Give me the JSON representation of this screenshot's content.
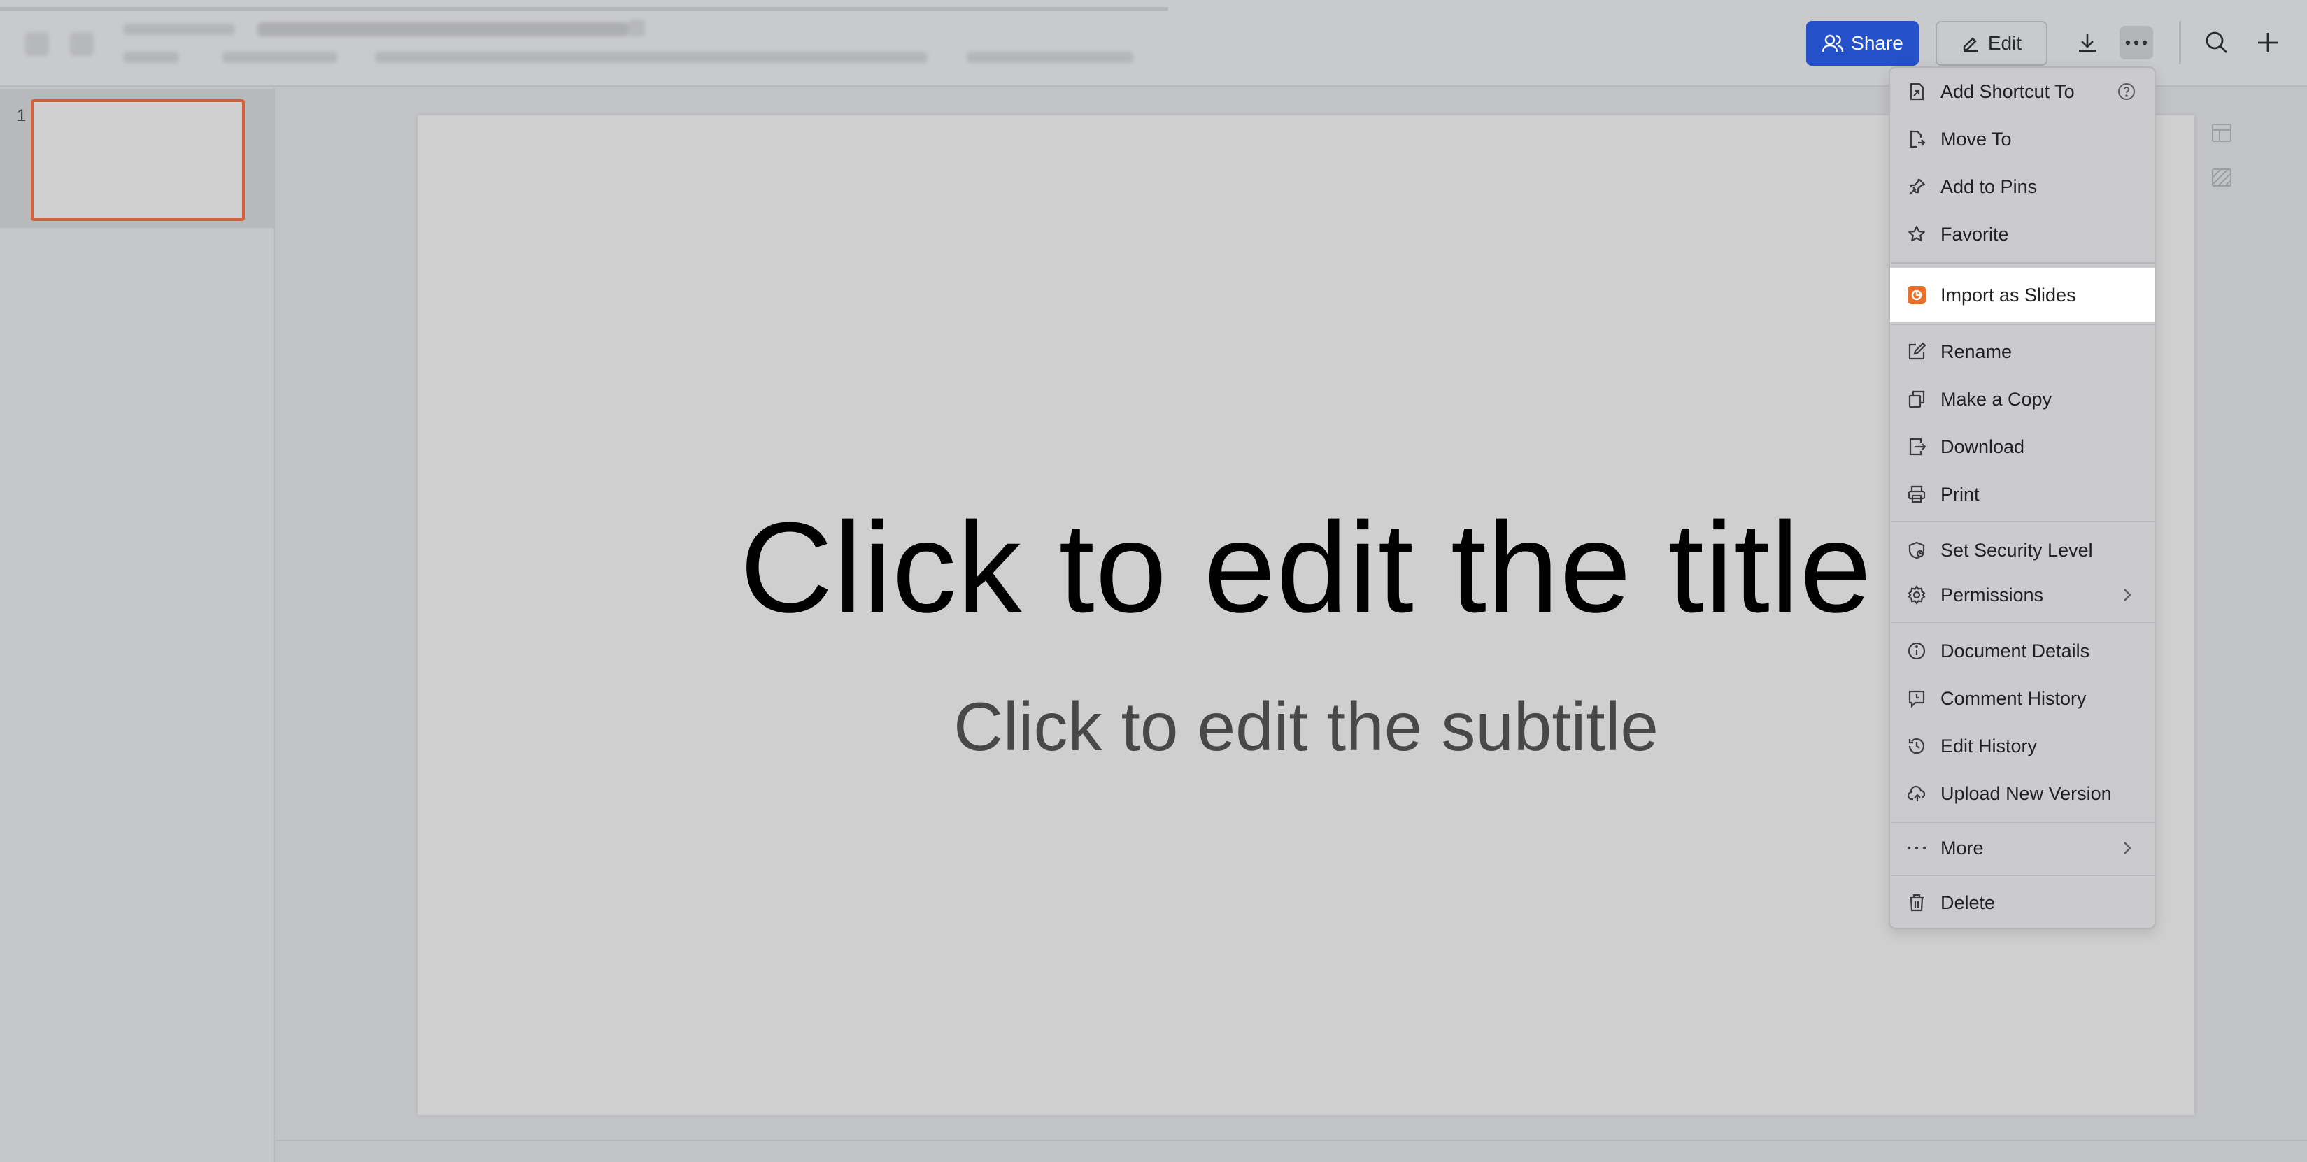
{
  "toolbar": {
    "share_label": "Share",
    "edit_label": "Edit"
  },
  "sidebar": {
    "slides": [
      {
        "number": "1"
      }
    ]
  },
  "slide": {
    "title": "Click to edit the title",
    "subtitle": "Click to edit the subtitle"
  },
  "menu": {
    "items": [
      {
        "label": "Add Shortcut To",
        "icon": "add-shortcut-icon"
      },
      {
        "label": "Move To",
        "icon": "move-to-icon"
      },
      {
        "label": "Add to Pins",
        "icon": "pin-icon"
      },
      {
        "label": "Favorite",
        "icon": "star-icon"
      },
      {
        "label": "Import as Slides",
        "icon": "slides-app-icon"
      },
      {
        "label": "Rename",
        "icon": "rename-icon"
      },
      {
        "label": "Make a Copy",
        "icon": "copy-icon"
      },
      {
        "label": "Download",
        "icon": "download-icon"
      },
      {
        "label": "Print",
        "icon": "print-icon"
      },
      {
        "label": "Set Security Level",
        "icon": "security-icon"
      },
      {
        "label": "Permissions",
        "icon": "gear-icon"
      },
      {
        "label": "Document Details",
        "icon": "info-icon"
      },
      {
        "label": "Comment History",
        "icon": "comment-history-icon"
      },
      {
        "label": "Edit History",
        "icon": "history-icon"
      },
      {
        "label": "Upload New Version",
        "icon": "cloud-upload-icon"
      },
      {
        "label": "More",
        "icon": "more-dots-icon"
      },
      {
        "label": "Delete",
        "icon": "trash-icon"
      }
    ]
  },
  "colors": {
    "share_button": "#2450c9",
    "slides_app_icon": "#e8702a",
    "thumbnail_selected_border": "#d2623f",
    "highlighted_item_bg": "#ffffff"
  }
}
